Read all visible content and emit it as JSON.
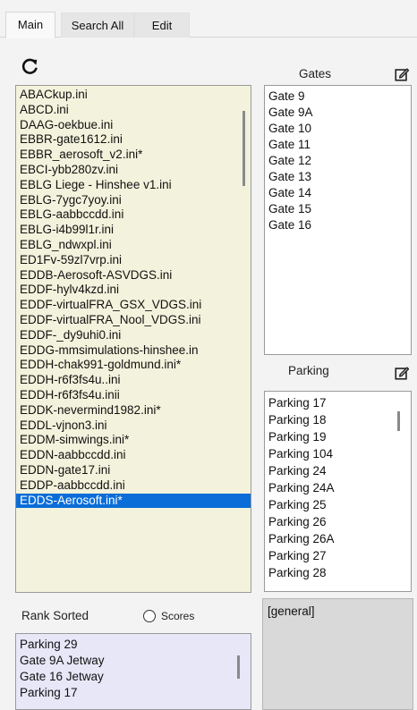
{
  "tabs": [
    {
      "label": "Main",
      "active": true
    },
    {
      "label": "Search All",
      "active": false
    },
    {
      "label": "Edit",
      "active": false
    }
  ],
  "icons": {
    "refresh": "refresh-icon",
    "edit": "edit-icon"
  },
  "colors": {
    "selection": "#0a6dd8",
    "files_bg": "#f3f2dc",
    "rank_bg": "#e7e7f8",
    "general_bg": "#d9d9d9"
  },
  "files": {
    "items": [
      "ABACkup.ini",
      "ABCD.ini",
      "DAAG-oekbue.ini",
      "EBBR-gate1612.ini",
      "EBBR_aerosoft_v2.ini*",
      "EBCI-ybb280zv.ini",
      "EBLG Liege - Hinshee v1.ini",
      "EBLG-7ygc7yoy.ini",
      "EBLG-aabbccdd.ini",
      "EBLG-i4b99l1r.ini",
      "EBLG_ndwxpl.ini",
      "ED1Fv-59zl7vrp.ini",
      "EDDB-Aerosoft-ASVDGS.ini",
      "EDDF-hylv4kzd.ini",
      "EDDF-virtualFRA_GSX_VDGS.ini",
      "EDDF-virtualFRA_Nool_VDGS.ini",
      "EDDF-_dy9uhi0.ini",
      "EDDG-mmsimulations-hinshee.in",
      "EDDH-chak991-goldmund.ini*",
      "EDDH-r6f3fs4u..ini",
      "EDDH-r6f3fs4u.inii",
      "EDDK-nevermind1982.ini*",
      "EDDL-vjnon3.ini",
      "EDDM-simwings.ini*",
      "EDDN-aabbccdd.ini",
      "EDDN-gate17.ini",
      "EDDP-aabbccdd.ini",
      "EDDS-Aerosoft.ini*"
    ],
    "selected_index": 27
  },
  "gates": {
    "title": "Gates",
    "items": [
      "Gate 9",
      "Gate 9A",
      "Gate 10",
      "Gate 11",
      "Gate 12",
      "Gate 13",
      "Gate 14",
      "Gate 15",
      "Gate 16"
    ]
  },
  "parking": {
    "title": "Parking",
    "items": [
      "Parking 17",
      "Parking 18",
      "Parking 19",
      "Parking 104",
      "Parking 24",
      "Parking 24A",
      "Parking 25",
      "Parking 26",
      "Parking 26A",
      "Parking 27",
      "Parking 28"
    ]
  },
  "rank": {
    "title": "Rank Sorted",
    "scores_label": "Scores",
    "items": [
      "Parking 29",
      "Gate 9A Jetway",
      "Gate 16 Jetway",
      "Parking 17"
    ]
  },
  "general": {
    "text": "[general]"
  }
}
